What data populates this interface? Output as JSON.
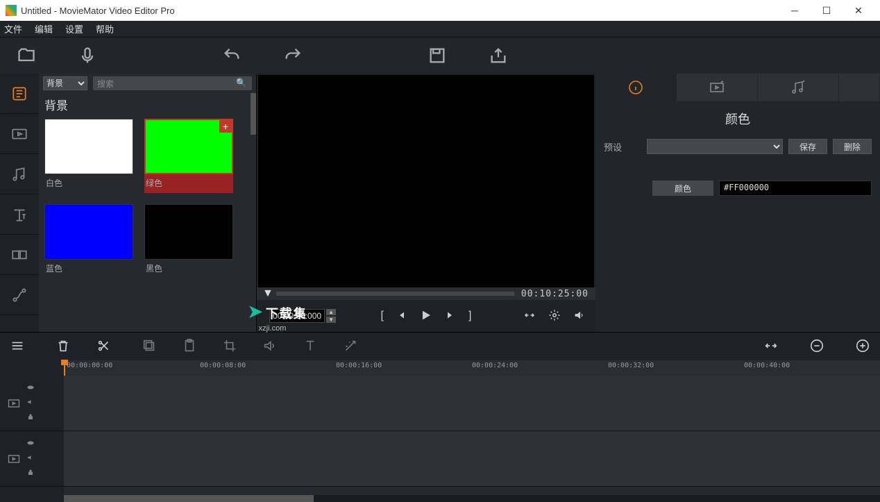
{
  "title": "Untitled - MovieMator Video Editor Pro",
  "menu": {
    "file": "文件",
    "edit": "编辑",
    "settings": "设置",
    "help": "帮助"
  },
  "library": {
    "category": "背景",
    "search_placeholder": "搜索",
    "heading": "背景",
    "items": [
      {
        "label": "白色",
        "color": "#ffffff"
      },
      {
        "label": "绿色",
        "color": "#00ff00",
        "selected": true
      },
      {
        "label": "蓝色",
        "color": "#0000ff"
      },
      {
        "label": "黑色",
        "color": "#000000"
      }
    ]
  },
  "preview": {
    "duration": "00:10:25:00",
    "position": "00:00:00:000"
  },
  "watermark": {
    "line1": "下载集",
    "line2": "xzji.com"
  },
  "props": {
    "panel_title": "颜色",
    "preset_label": "预设",
    "save": "保存",
    "delete": "删除",
    "color_btn": "颜色",
    "color_value": "#FF000000"
  },
  "ruler": {
    "playhead": "00:00:00:00",
    "ticks": [
      "00:00:08:00",
      "00:00:16:00",
      "00:00:24:00",
      "00:00:32:00",
      "00:00:40:00"
    ]
  }
}
